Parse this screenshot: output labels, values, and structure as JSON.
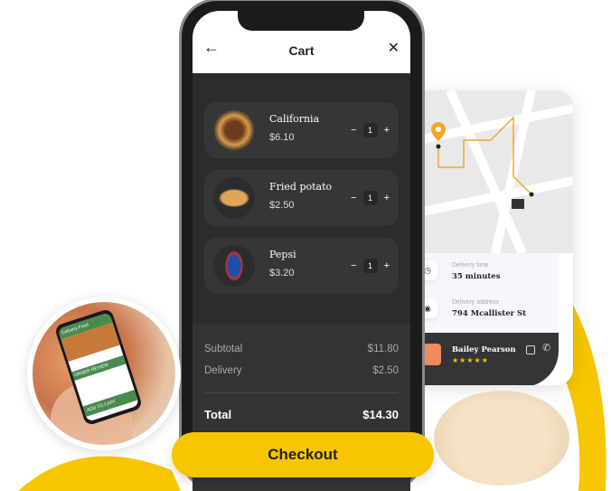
{
  "colors": {
    "accent": "#f7c600",
    "dark": "#2b2c2e",
    "map_route": "#f5a623"
  },
  "cart": {
    "title": "Cart",
    "back_icon": "arrow-left-icon",
    "close_icon": "close-icon",
    "items": [
      {
        "name": "California",
        "price": "$6.10",
        "quantity": "1",
        "image": "burger"
      },
      {
        "name": "Fried potato",
        "price": "$2.50",
        "quantity": "1",
        "image": "fries"
      },
      {
        "name": "Pepsi",
        "price": "$3.20",
        "quantity": "1",
        "image": "pepsi-cup"
      }
    ],
    "stepper": {
      "minus": "−",
      "plus": "+"
    },
    "summary": {
      "subtotal_label": "Subtotal",
      "subtotal": "$11.80",
      "delivery_label": "Delivery",
      "delivery": "$2.50",
      "total_label": "Total",
      "total": "$14.30"
    },
    "checkout_label": "Checkout"
  },
  "tracking": {
    "delivery_time_label": "Delivery time",
    "delivery_time": "35 minutes",
    "delivery_address_label": "Delivery address",
    "delivery_address": "794 Mcallister St",
    "driver_name": "Bailey Pearson",
    "driver_rating": 5,
    "rating_stars": "★★★★★"
  },
  "photo": {
    "app_title": "Delivery Food",
    "section": "ORDER REVIEW",
    "cta": "ADD TO CART"
  }
}
